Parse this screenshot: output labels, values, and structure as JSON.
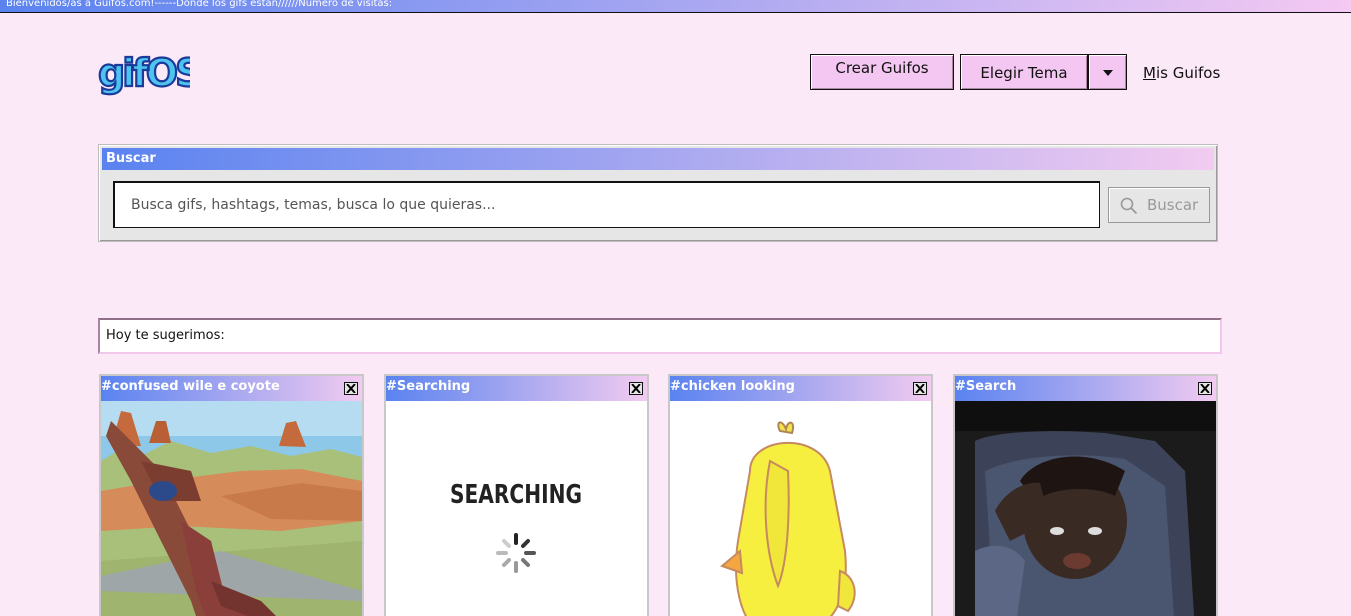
{
  "topbar": {
    "text": "Bienvenidos/as a Guifos.com!------Donde los gifs están//////Número de visitas:"
  },
  "logo": {
    "text": "gifOS"
  },
  "header": {
    "create_button": "Crear Guifos",
    "theme_button": "Elegir Tema",
    "my_gifs_link_first": "M",
    "my_gifs_link_rest": "is Guifos"
  },
  "search": {
    "title": "Buscar",
    "placeholder": "Busca gifs, hashtags, temas, busca lo que quieras...",
    "button_label": "Buscar"
  },
  "suggestions": {
    "label": "Hoy te sugerimos:",
    "cards": [
      {
        "tag": "#confused wile e coyote",
        "image": "coyote-cartoon"
      },
      {
        "tag": "#Searching",
        "image": "searching-spinner",
        "image_text": "SEARCHING"
      },
      {
        "tag": "#chicken looking",
        "image": "yellow-chick-cartoon"
      },
      {
        "tag": "#Search",
        "image": "man-looking-photo"
      }
    ]
  },
  "colors": {
    "background": "#fbe9f8",
    "accent_pink": "#f4c7f2",
    "gradient_start": "#5a83f0",
    "gradient_end": "#f2cbf0"
  }
}
